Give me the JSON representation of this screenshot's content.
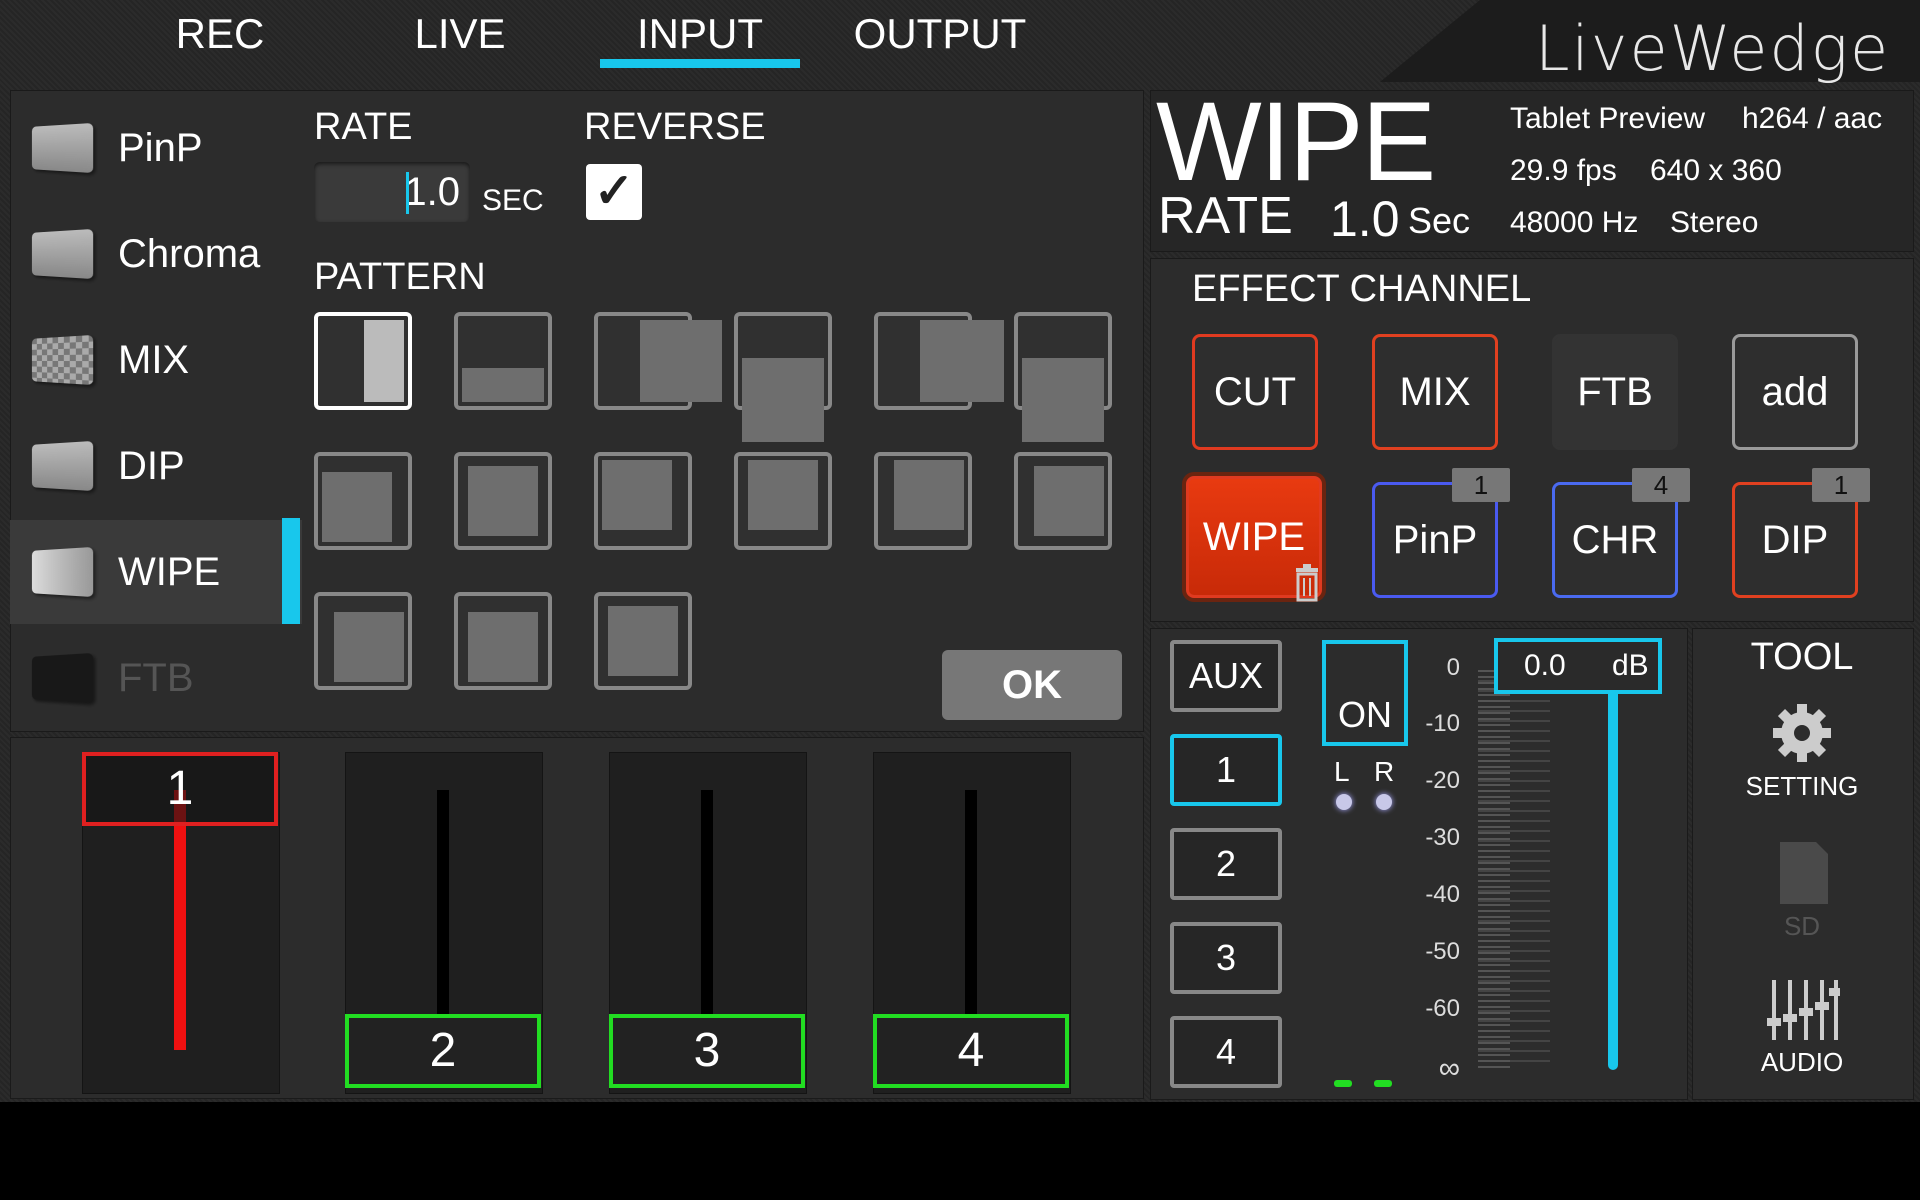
{
  "tabs": [
    {
      "label": "REC"
    },
    {
      "label": "LIVE"
    },
    {
      "label": "INPUT"
    },
    {
      "label": "OUTPUT"
    }
  ],
  "brand": "LiveWedge",
  "effects_list": [
    {
      "label": "PinP"
    },
    {
      "label": "Chroma"
    },
    {
      "label": "MIX"
    },
    {
      "label": "DIP"
    },
    {
      "label": "WIPE"
    },
    {
      "label": "FTB"
    }
  ],
  "settings": {
    "rate_label": "RATE",
    "rate_value": "1.0",
    "rate_unit": "SEC",
    "reverse_label": "REVERSE",
    "reverse_checked_glyph": "✓",
    "pattern_label": "PATTERN",
    "ok_label": "OK"
  },
  "faders": [
    {
      "label": "1"
    },
    {
      "label": "2"
    },
    {
      "label": "3"
    },
    {
      "label": "4"
    }
  ],
  "info": {
    "effect": "WIPE",
    "rate_label": "RATE",
    "rate_value": "1.0",
    "rate_unit": "Sec",
    "preview": "Tablet Preview",
    "codec": "h264 / aac",
    "fps": "29.9  fps",
    "resolution": "640 x 360",
    "hz": "48000  Hz",
    "channels": "Stereo"
  },
  "effect_channel": {
    "title": "EFFECT CHANNEL",
    "buttons": [
      {
        "label": "CUT",
        "color": "#e03a20"
      },
      {
        "label": "MIX",
        "color": "#e04020"
      },
      {
        "label": "FTB",
        "color": "#333333"
      },
      {
        "label": "add",
        "color": "#9a9a9a"
      },
      {
        "label": "WIPE",
        "color": "#f04a10"
      },
      {
        "label": "PinP",
        "color": "#4a5af0",
        "badge": "1"
      },
      {
        "label": "CHR",
        "color": "#4a6af0",
        "badge": "4"
      },
      {
        "label": "DIP",
        "color": "#e04020",
        "badge": "1"
      }
    ]
  },
  "audio": {
    "sources": [
      {
        "label": "AUX"
      },
      {
        "label": "1"
      },
      {
        "label": "2"
      },
      {
        "label": "3"
      },
      {
        "label": "4"
      }
    ],
    "on_label": "ON",
    "left_label": "L",
    "right_label": "R",
    "db_value": "0.0",
    "db_unit": "dB",
    "scale": [
      "0",
      "-10",
      "-20",
      "-30",
      "-40",
      "-50",
      "-60",
      "∞"
    ]
  },
  "tool": {
    "title": "TOOL",
    "setting_label": "SETTING",
    "sd_label": "SD",
    "audio_label": "AUDIO"
  },
  "colors": {
    "accent": "#18c7ec",
    "active_fader": "#e02020",
    "preview_fader": "#22dd22"
  }
}
